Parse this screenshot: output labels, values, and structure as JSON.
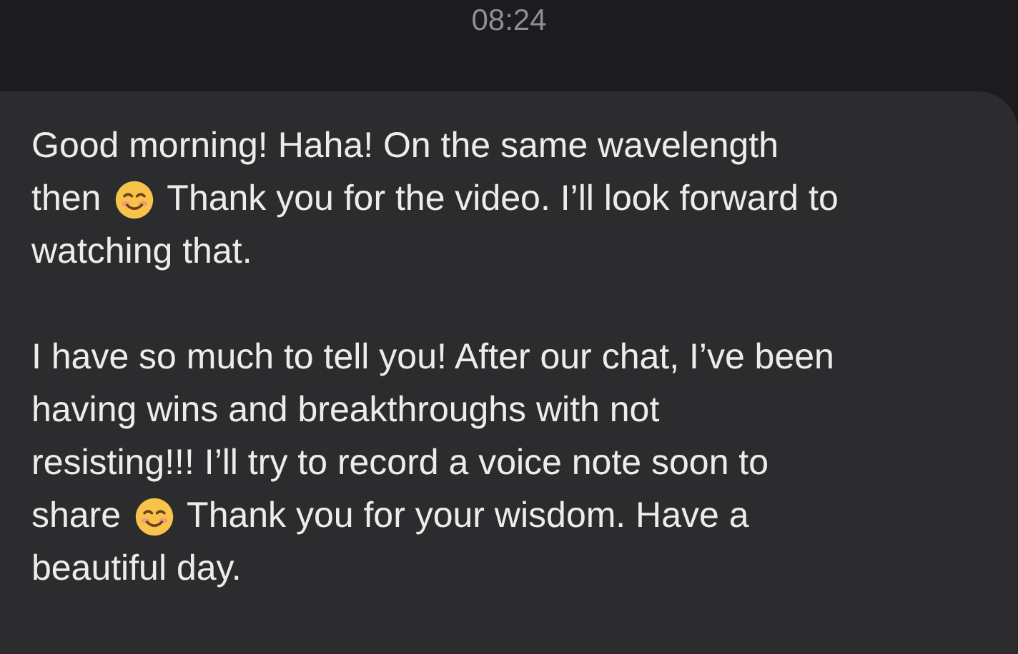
{
  "timestamp": "08:24",
  "message": {
    "paragraphs": [
      {
        "lines": [
          [
            {
              "kind": "text",
              "text": "Good morning! Haha! On the same wavelength"
            }
          ],
          [
            {
              "kind": "text",
              "text": "then"
            },
            {
              "kind": "emoji"
            },
            {
              "kind": "text",
              "text": "Thank you for the video. I’ll look forward to"
            }
          ],
          [
            {
              "kind": "text",
              "text": "watching that."
            }
          ]
        ]
      },
      {
        "lines": [
          [
            {
              "kind": "text",
              "text": "I have so much to tell you! After our chat, I’ve been"
            }
          ],
          [
            {
              "kind": "text",
              "text": "having wins and breakthroughs with not"
            }
          ],
          [
            {
              "kind": "text",
              "text": "resisting!!! I’ll try to record a voice note soon to"
            }
          ],
          [
            {
              "kind": "text",
              "text": "share"
            },
            {
              "kind": "emoji"
            },
            {
              "kind": "text",
              "text": "Thank you for your wisdom. Have a"
            }
          ],
          [
            {
              "kind": "text",
              "text": "beautiful day."
            }
          ]
        ]
      }
    ]
  }
}
